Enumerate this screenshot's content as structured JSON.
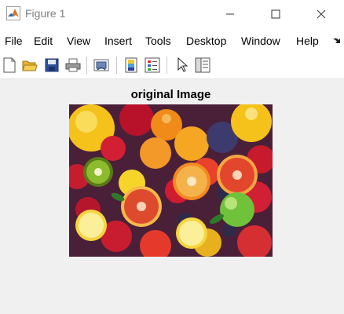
{
  "window": {
    "title": "Figure 1",
    "icon": "matlab-logo-icon",
    "controls": [
      "minimize-icon",
      "maximize-icon",
      "close-icon"
    ]
  },
  "menu": {
    "items": [
      "File",
      "Edit",
      "View",
      "Insert",
      "Tools",
      "Desktop",
      "Window",
      "Help"
    ],
    "overflow_icon": "dock-arrow-icon"
  },
  "toolbar": {
    "buttons": [
      "new-figure-icon",
      "open-file-icon",
      "save-icon",
      "print-icon",
      "link-plot-icon",
      "colorbar-icon",
      "legend-icon",
      "edit-plot-arrow-icon",
      "property-editor-icon"
    ]
  },
  "figure": {
    "title": "original Image",
    "image_description_icon": "fruit-photo-image"
  }
}
